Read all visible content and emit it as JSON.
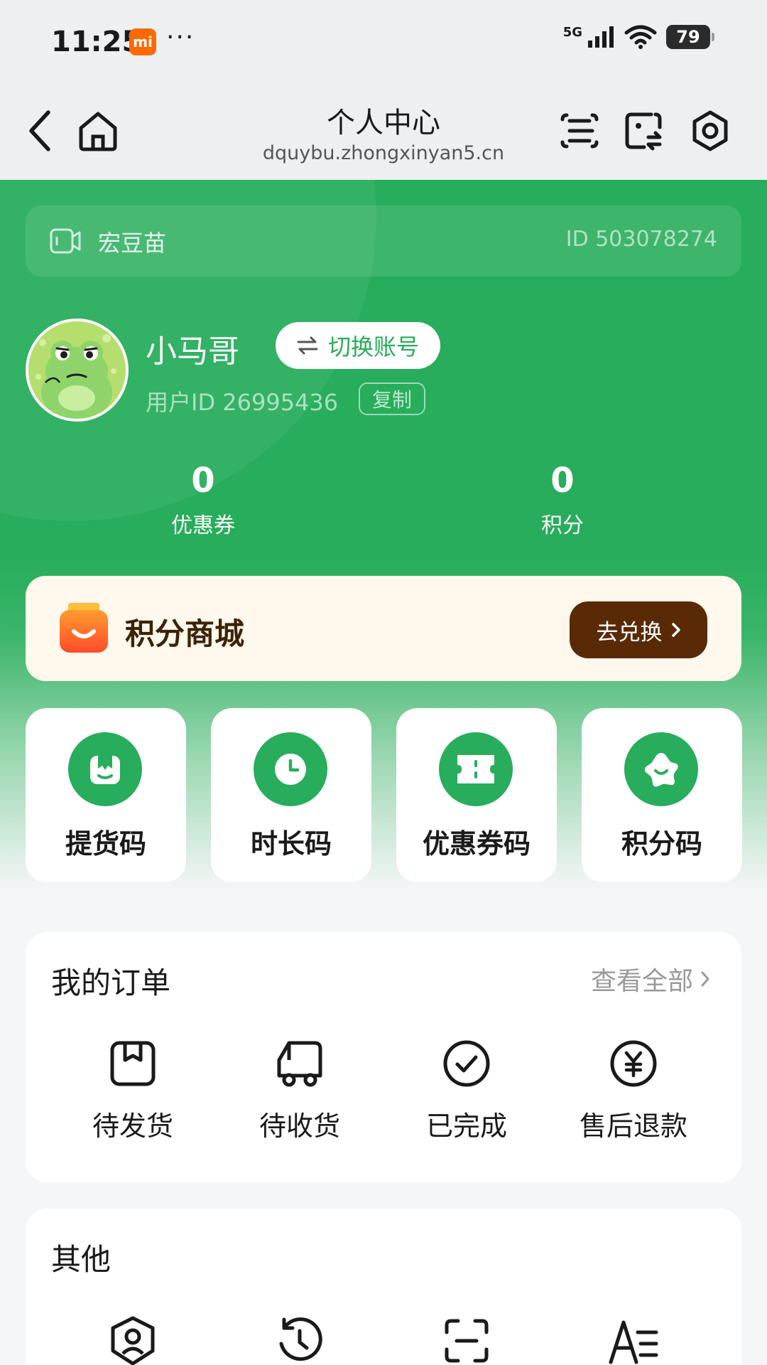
{
  "status_bar": {
    "time": "11:25",
    "mi_badge": "mi",
    "dots": "···",
    "network": "5G",
    "battery": "79"
  },
  "title_bar": {
    "title": "个人中心",
    "url": "dquybu.zhongxinyan5.cn"
  },
  "store": {
    "name": "宏豆苗",
    "id_text": "ID 503078274"
  },
  "user": {
    "name": "小马哥",
    "switch_label": "切换账号",
    "user_id_text": "用户ID 26995436",
    "copy_label": "复制"
  },
  "stats": [
    {
      "value": "0",
      "label": "优惠券"
    },
    {
      "value": "0",
      "label": "积分"
    }
  ],
  "mall": {
    "title": "积分商城",
    "button_label": "去兑换"
  },
  "codes": [
    {
      "label": "提货码",
      "icon": "bag-icon"
    },
    {
      "label": "时长码",
      "icon": "clock-icon"
    },
    {
      "label": "优惠券码",
      "icon": "ticket-icon"
    },
    {
      "label": "积分码",
      "icon": "star-badge-icon"
    }
  ],
  "orders": {
    "title": "我的订单",
    "view_all": "查看全部",
    "items": [
      {
        "label": "待发货",
        "icon": "package-icon"
      },
      {
        "label": "待收货",
        "icon": "truck-icon"
      },
      {
        "label": "已完成",
        "icon": "check-circle-icon"
      },
      {
        "label": "售后退款",
        "icon": "yuan-circle-icon"
      }
    ]
  },
  "other": {
    "title": "其他",
    "items": [
      {
        "icon": "user-shield-icon"
      },
      {
        "icon": "history-icon"
      },
      {
        "icon": "scan-icon"
      },
      {
        "icon": "text-size-icon"
      }
    ]
  },
  "colors": {
    "brand_green": "#27ad5b",
    "mall_bg": "#fff8ec",
    "mall_button": "#5a2a06"
  }
}
